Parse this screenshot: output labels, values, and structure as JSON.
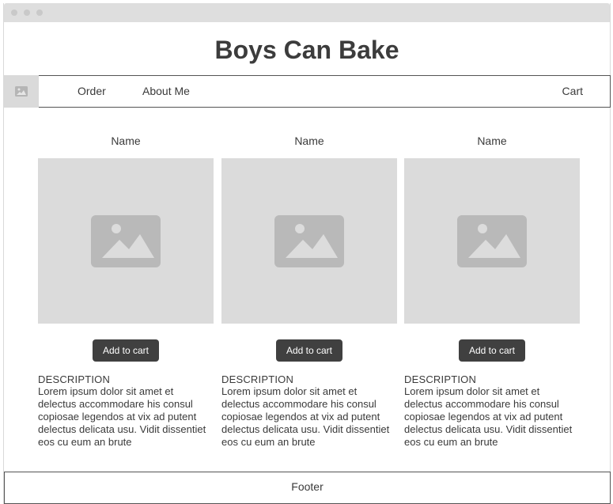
{
  "site": {
    "title": "Boys Can Bake"
  },
  "nav": {
    "logo_icon": "image-icon",
    "order": "Order",
    "about": "About Me",
    "cart": "Cart"
  },
  "products": [
    {
      "name": "Name",
      "image_icon": "image-placeholder-icon",
      "button": "Add to cart",
      "desc_title": "DESCRIPTION",
      "desc_body": "Lorem ipsum dolor sit amet et delectus accommodare his consul copiosae legendos at vix ad putent delectus delicata usu. Vidit dissentiet eos cu eum an brute"
    },
    {
      "name": "Name",
      "image_icon": "image-placeholder-icon",
      "button": "Add to cart",
      "desc_title": "DESCRIPTION",
      "desc_body": "Lorem ipsum dolor sit amet et delectus accommodare his consul copiosae legendos at vix ad putent delectus delicata usu. Vidit dissentiet eos cu eum an brute"
    },
    {
      "name": "Name",
      "image_icon": "image-placeholder-icon",
      "button": "Add to cart",
      "desc_title": "DESCRIPTION",
      "desc_body": "Lorem ipsum dolor sit amet et delectus accommodare his consul copiosae legendos at vix ad putent delectus delicata usu. Vidit dissentiet eos cu eum an brute"
    }
  ],
  "footer": {
    "text": "Footer"
  },
  "colors": {
    "placeholder": "#dbdbdb",
    "placeholder_icon": "#b9b9b9",
    "button": "#404040",
    "border": "#545454"
  }
}
